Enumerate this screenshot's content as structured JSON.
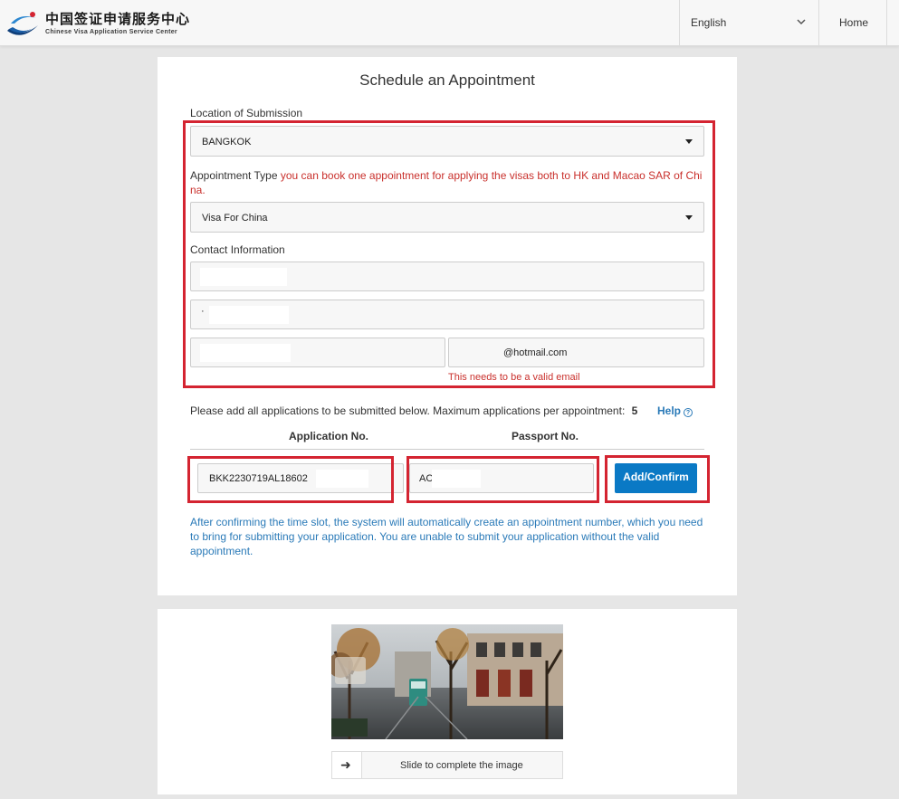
{
  "header": {
    "logo_cn": "中国签证申请服务中心",
    "logo_en": "Chinese Visa Application Service Center",
    "language": "English",
    "home": "Home"
  },
  "form": {
    "title": "Schedule an Appointment",
    "location_label": "Location of Submission",
    "location_value": "BANGKOK",
    "appt_type_label": "Appointment Type",
    "appt_type_note_line1": "you can book one appointment for applying the visas both to HK and Macao SAR of Chi",
    "appt_type_note_line2": "na.",
    "appt_type_value": "Visa For China",
    "contact_label": "Contact Information",
    "contact_line2_prefix": "·",
    "email_domain": "@hotmail.com",
    "email_error": "This needs to be a valid email",
    "apps_note": "Please add all applications to be submitted below. Maximum applications per appointment:",
    "apps_max": "5",
    "help": "Help",
    "col_application": "Application No.",
    "col_passport": "Passport No.",
    "application_no": "BKK2230719AL18602",
    "passport_no": "AC",
    "add_confirm": "Add/Confirm",
    "info": "After confirming the time slot, the system will automatically create an appointment number, which you need to bring for submitting your application. You are unable to submit your application without the valid appointment."
  },
  "captcha": {
    "slider_text": "Slide to complete the image",
    "arrow": "➜"
  },
  "colors": {
    "accent": "#0a79c5",
    "error": "#c9302c",
    "highlight": "#d42431"
  }
}
